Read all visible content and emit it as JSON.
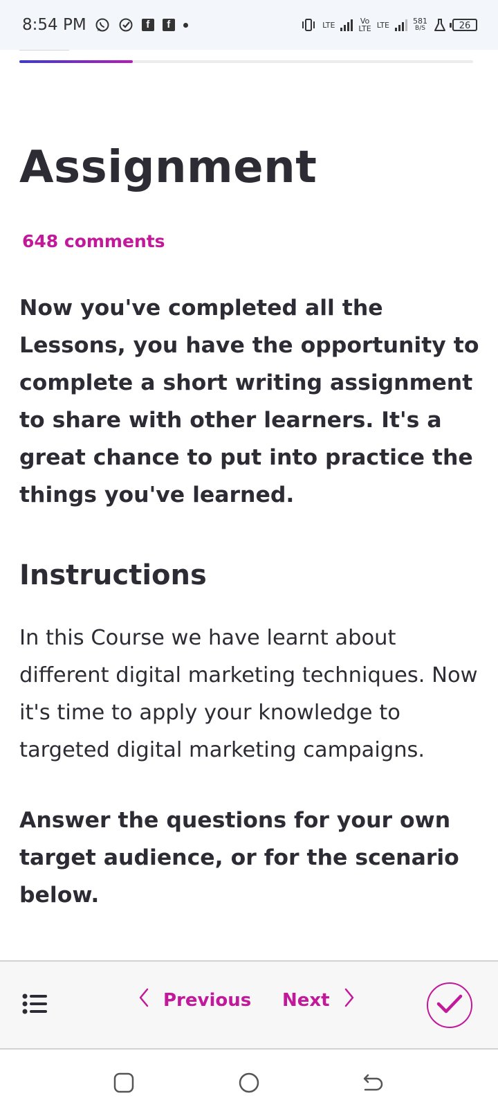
{
  "status_bar": {
    "time": "8:54 PM",
    "left_icons": [
      "whatsapp-icon",
      "check-circle-icon",
      "facebook-icon",
      "facebook-icon",
      "dot-icon"
    ],
    "network1_top": "LTE",
    "network2_top": "Vo",
    "network2_bottom": "LTE",
    "network3_top": "LTE",
    "speed_value": "581",
    "speed_unit": "B/S",
    "battery": "26"
  },
  "progress": {
    "fraction": 0.25,
    "gradient_start": "#3c3ad6",
    "gradient_end": "#b41cb8"
  },
  "content": {
    "title": "Assignment",
    "comments": "648 comments",
    "intro": "Now you've completed all the Lessons, you have the opportunity to complete a short writing assignment to share with other learners. It's a great chance to put into practice the things you've learned.",
    "instructions_heading": "Instructions",
    "instructions_body": "In this Course we have learnt about different digital marketing techniques. Now it's time to apply your knowledge to targeted digital marketing campaigns.",
    "answer_prompt": "Answer the questions for your own target audience, or for the scenario below."
  },
  "bottom_nav": {
    "menu_icon": "list-icon",
    "previous_label": "Previous",
    "next_label": "Next",
    "complete_icon": "check-icon",
    "accent_color": "#c2189a"
  },
  "system_nav": {
    "icons": [
      "recent-apps-icon",
      "home-icon",
      "back-icon"
    ]
  }
}
